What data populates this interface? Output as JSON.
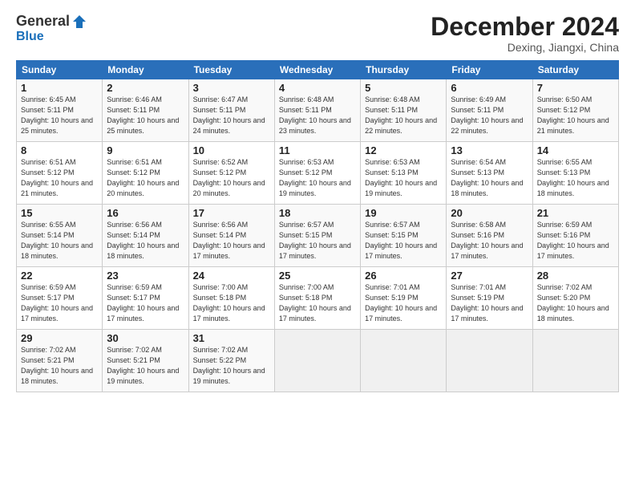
{
  "logo": {
    "general": "General",
    "blue": "Blue"
  },
  "header": {
    "month": "December 2024",
    "location": "Dexing, Jiangxi, China"
  },
  "days_of_week": [
    "Sunday",
    "Monday",
    "Tuesday",
    "Wednesday",
    "Thursday",
    "Friday",
    "Saturday"
  ],
  "weeks": [
    [
      {
        "day": "1",
        "sunrise": "6:45 AM",
        "sunset": "5:11 PM",
        "daylight": "10 hours and 25 minutes."
      },
      {
        "day": "2",
        "sunrise": "6:46 AM",
        "sunset": "5:11 PM",
        "daylight": "10 hours and 25 minutes."
      },
      {
        "day": "3",
        "sunrise": "6:47 AM",
        "sunset": "5:11 PM",
        "daylight": "10 hours and 24 minutes."
      },
      {
        "day": "4",
        "sunrise": "6:48 AM",
        "sunset": "5:11 PM",
        "daylight": "10 hours and 23 minutes."
      },
      {
        "day": "5",
        "sunrise": "6:48 AM",
        "sunset": "5:11 PM",
        "daylight": "10 hours and 22 minutes."
      },
      {
        "day": "6",
        "sunrise": "6:49 AM",
        "sunset": "5:11 PM",
        "daylight": "10 hours and 22 minutes."
      },
      {
        "day": "7",
        "sunrise": "6:50 AM",
        "sunset": "5:12 PM",
        "daylight": "10 hours and 21 minutes."
      }
    ],
    [
      {
        "day": "8",
        "sunrise": "6:51 AM",
        "sunset": "5:12 PM",
        "daylight": "10 hours and 21 minutes."
      },
      {
        "day": "9",
        "sunrise": "6:51 AM",
        "sunset": "5:12 PM",
        "daylight": "10 hours and 20 minutes."
      },
      {
        "day": "10",
        "sunrise": "6:52 AM",
        "sunset": "5:12 PM",
        "daylight": "10 hours and 20 minutes."
      },
      {
        "day": "11",
        "sunrise": "6:53 AM",
        "sunset": "5:12 PM",
        "daylight": "10 hours and 19 minutes."
      },
      {
        "day": "12",
        "sunrise": "6:53 AM",
        "sunset": "5:13 PM",
        "daylight": "10 hours and 19 minutes."
      },
      {
        "day": "13",
        "sunrise": "6:54 AM",
        "sunset": "5:13 PM",
        "daylight": "10 hours and 18 minutes."
      },
      {
        "day": "14",
        "sunrise": "6:55 AM",
        "sunset": "5:13 PM",
        "daylight": "10 hours and 18 minutes."
      }
    ],
    [
      {
        "day": "15",
        "sunrise": "6:55 AM",
        "sunset": "5:14 PM",
        "daylight": "10 hours and 18 minutes."
      },
      {
        "day": "16",
        "sunrise": "6:56 AM",
        "sunset": "5:14 PM",
        "daylight": "10 hours and 18 minutes."
      },
      {
        "day": "17",
        "sunrise": "6:56 AM",
        "sunset": "5:14 PM",
        "daylight": "10 hours and 17 minutes."
      },
      {
        "day": "18",
        "sunrise": "6:57 AM",
        "sunset": "5:15 PM",
        "daylight": "10 hours and 17 minutes."
      },
      {
        "day": "19",
        "sunrise": "6:57 AM",
        "sunset": "5:15 PM",
        "daylight": "10 hours and 17 minutes."
      },
      {
        "day": "20",
        "sunrise": "6:58 AM",
        "sunset": "5:16 PM",
        "daylight": "10 hours and 17 minutes."
      },
      {
        "day": "21",
        "sunrise": "6:59 AM",
        "sunset": "5:16 PM",
        "daylight": "10 hours and 17 minutes."
      }
    ],
    [
      {
        "day": "22",
        "sunrise": "6:59 AM",
        "sunset": "5:17 PM",
        "daylight": "10 hours and 17 minutes."
      },
      {
        "day": "23",
        "sunrise": "6:59 AM",
        "sunset": "5:17 PM",
        "daylight": "10 hours and 17 minutes."
      },
      {
        "day": "24",
        "sunrise": "7:00 AM",
        "sunset": "5:18 PM",
        "daylight": "10 hours and 17 minutes."
      },
      {
        "day": "25",
        "sunrise": "7:00 AM",
        "sunset": "5:18 PM",
        "daylight": "10 hours and 17 minutes."
      },
      {
        "day": "26",
        "sunrise": "7:01 AM",
        "sunset": "5:19 PM",
        "daylight": "10 hours and 17 minutes."
      },
      {
        "day": "27",
        "sunrise": "7:01 AM",
        "sunset": "5:19 PM",
        "daylight": "10 hours and 17 minutes."
      },
      {
        "day": "28",
        "sunrise": "7:02 AM",
        "sunset": "5:20 PM",
        "daylight": "10 hours and 18 minutes."
      }
    ],
    [
      {
        "day": "29",
        "sunrise": "7:02 AM",
        "sunset": "5:21 PM",
        "daylight": "10 hours and 18 minutes."
      },
      {
        "day": "30",
        "sunrise": "7:02 AM",
        "sunset": "5:21 PM",
        "daylight": "10 hours and 19 minutes."
      },
      {
        "day": "31",
        "sunrise": "7:02 AM",
        "sunset": "5:22 PM",
        "daylight": "10 hours and 19 minutes."
      },
      null,
      null,
      null,
      null
    ]
  ]
}
